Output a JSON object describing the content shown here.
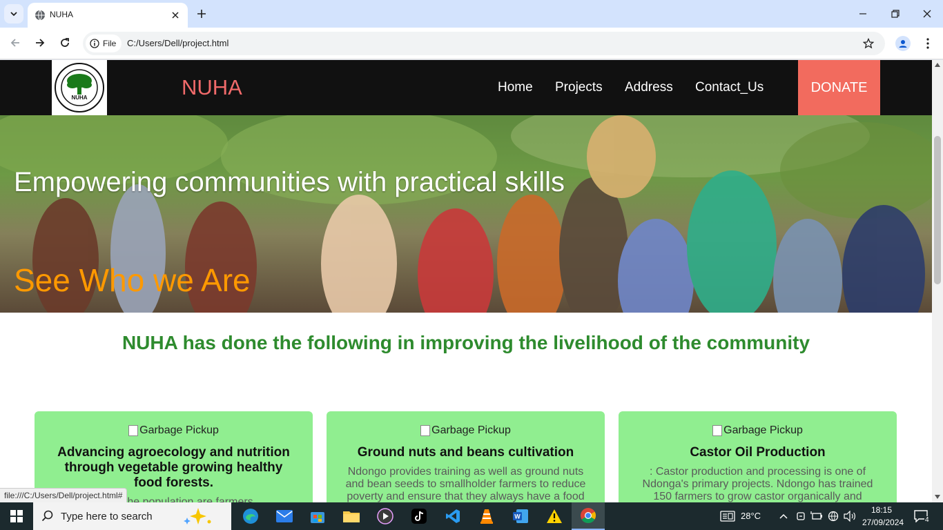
{
  "browser": {
    "tab_title": "NUHA",
    "url_chip": "File",
    "url": "C:/Users/Dell/project.html",
    "status_url": "file:///C:/Users/Dell/project.html#"
  },
  "site": {
    "brand": "NUHA",
    "nav": [
      "Home",
      "Projects",
      "Address",
      "Contact_Us"
    ],
    "donate": "DONATE",
    "hero_title": "Empowering communities with practical skills",
    "hero_subtitle": "See Who we Are",
    "section_title": "NUHA has done the following in improving the livelihood of the community",
    "cards": [
      {
        "img_alt": "Garbage Pickup",
        "title": "Advancing agroecology and nutrition through vegetable growing healthy food forests.",
        "text": "...y of the population are farmers"
      },
      {
        "img_alt": "Garbage Pickup",
        "title": "Ground nuts and beans cultivation",
        "text": "Ndongo provides training as well as ground nuts and bean seeds to smallholder farmers to reduce poverty and ensure that they always have a food"
      },
      {
        "img_alt": "Garbage Pickup",
        "title": "Castor Oil Production",
        "text": ": Castor production and processing is one of Ndonga's primary projects. Ndongo has trained 150 farmers to grow castor organically and"
      }
    ]
  },
  "taskbar": {
    "search_placeholder": "Type here to search",
    "weather": "28°C",
    "time": "18:15",
    "date": "27/09/2024",
    "notifications": "4"
  },
  "colors": {
    "nav_bg": "#111111",
    "brand": "#f06a6a",
    "donate_bg": "#f26b5e",
    "hero_subtitle": "#ff9900",
    "section_title": "#2e8b2e",
    "card_bg": "#90ee90"
  }
}
